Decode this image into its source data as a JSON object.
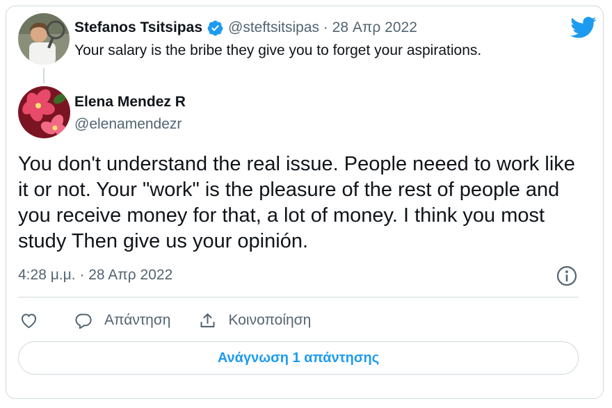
{
  "parent_tweet": {
    "author_name": "Stefanos Tsitsipas",
    "handle_date": "@steftsitsipas · 28 Απρ 2022",
    "text": "Your salary is the bribe they give you to forget your aspirations.",
    "verified_icon": "verified-badge-icon",
    "brand_icon": "twitter-bird-icon"
  },
  "reply_tweet": {
    "author_name": "Elena Mendez R",
    "handle": "@elenamendezr",
    "text": "You don't understand the real issue. People neeed to work like it or not. Your \"work\" is the pleasure of the rest of people and you receive money for that, a lot of money. I think you most study Then give us your opinión.",
    "timestamp": "4:28 μ.μ. · 28 Απρ 2022"
  },
  "actions": {
    "reply_label": "Απάντηση",
    "share_label": "Κοινοποίηση"
  },
  "read_replies_button": "Ανάγνωση 1 απάντησης",
  "colors": {
    "accent": "#1d9bf0",
    "secondary_text": "#536471",
    "border": "#cfd9de"
  }
}
